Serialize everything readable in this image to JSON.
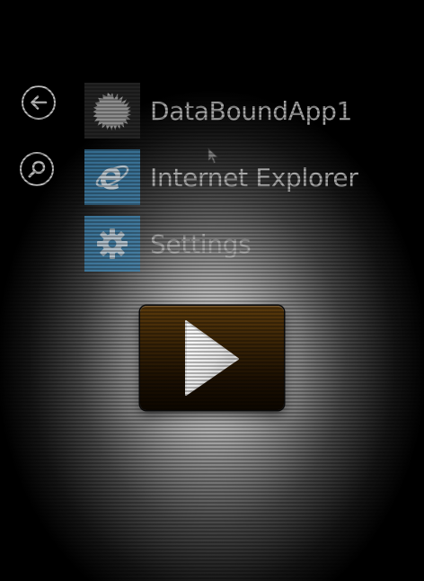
{
  "navigation": {
    "back_icon": "back-arrow-icon",
    "search_icon": "search-icon"
  },
  "apps": [
    {
      "label": "DataBoundApp1",
      "icon": "sun-badge-icon",
      "tile_color": "#282828"
    },
    {
      "label": "Internet Explorer",
      "icon": "internet-explorer-icon",
      "tile_color": "#3f82ad"
    },
    {
      "label": "Settings",
      "icon": "gear-icon",
      "tile_color": "#3f82ad"
    }
  ],
  "player": {
    "icon": "play-icon",
    "accent_color": "#3a2406"
  },
  "colors": {
    "label_text": "#a8a8a8",
    "tile_blue": "#3f82ad"
  }
}
